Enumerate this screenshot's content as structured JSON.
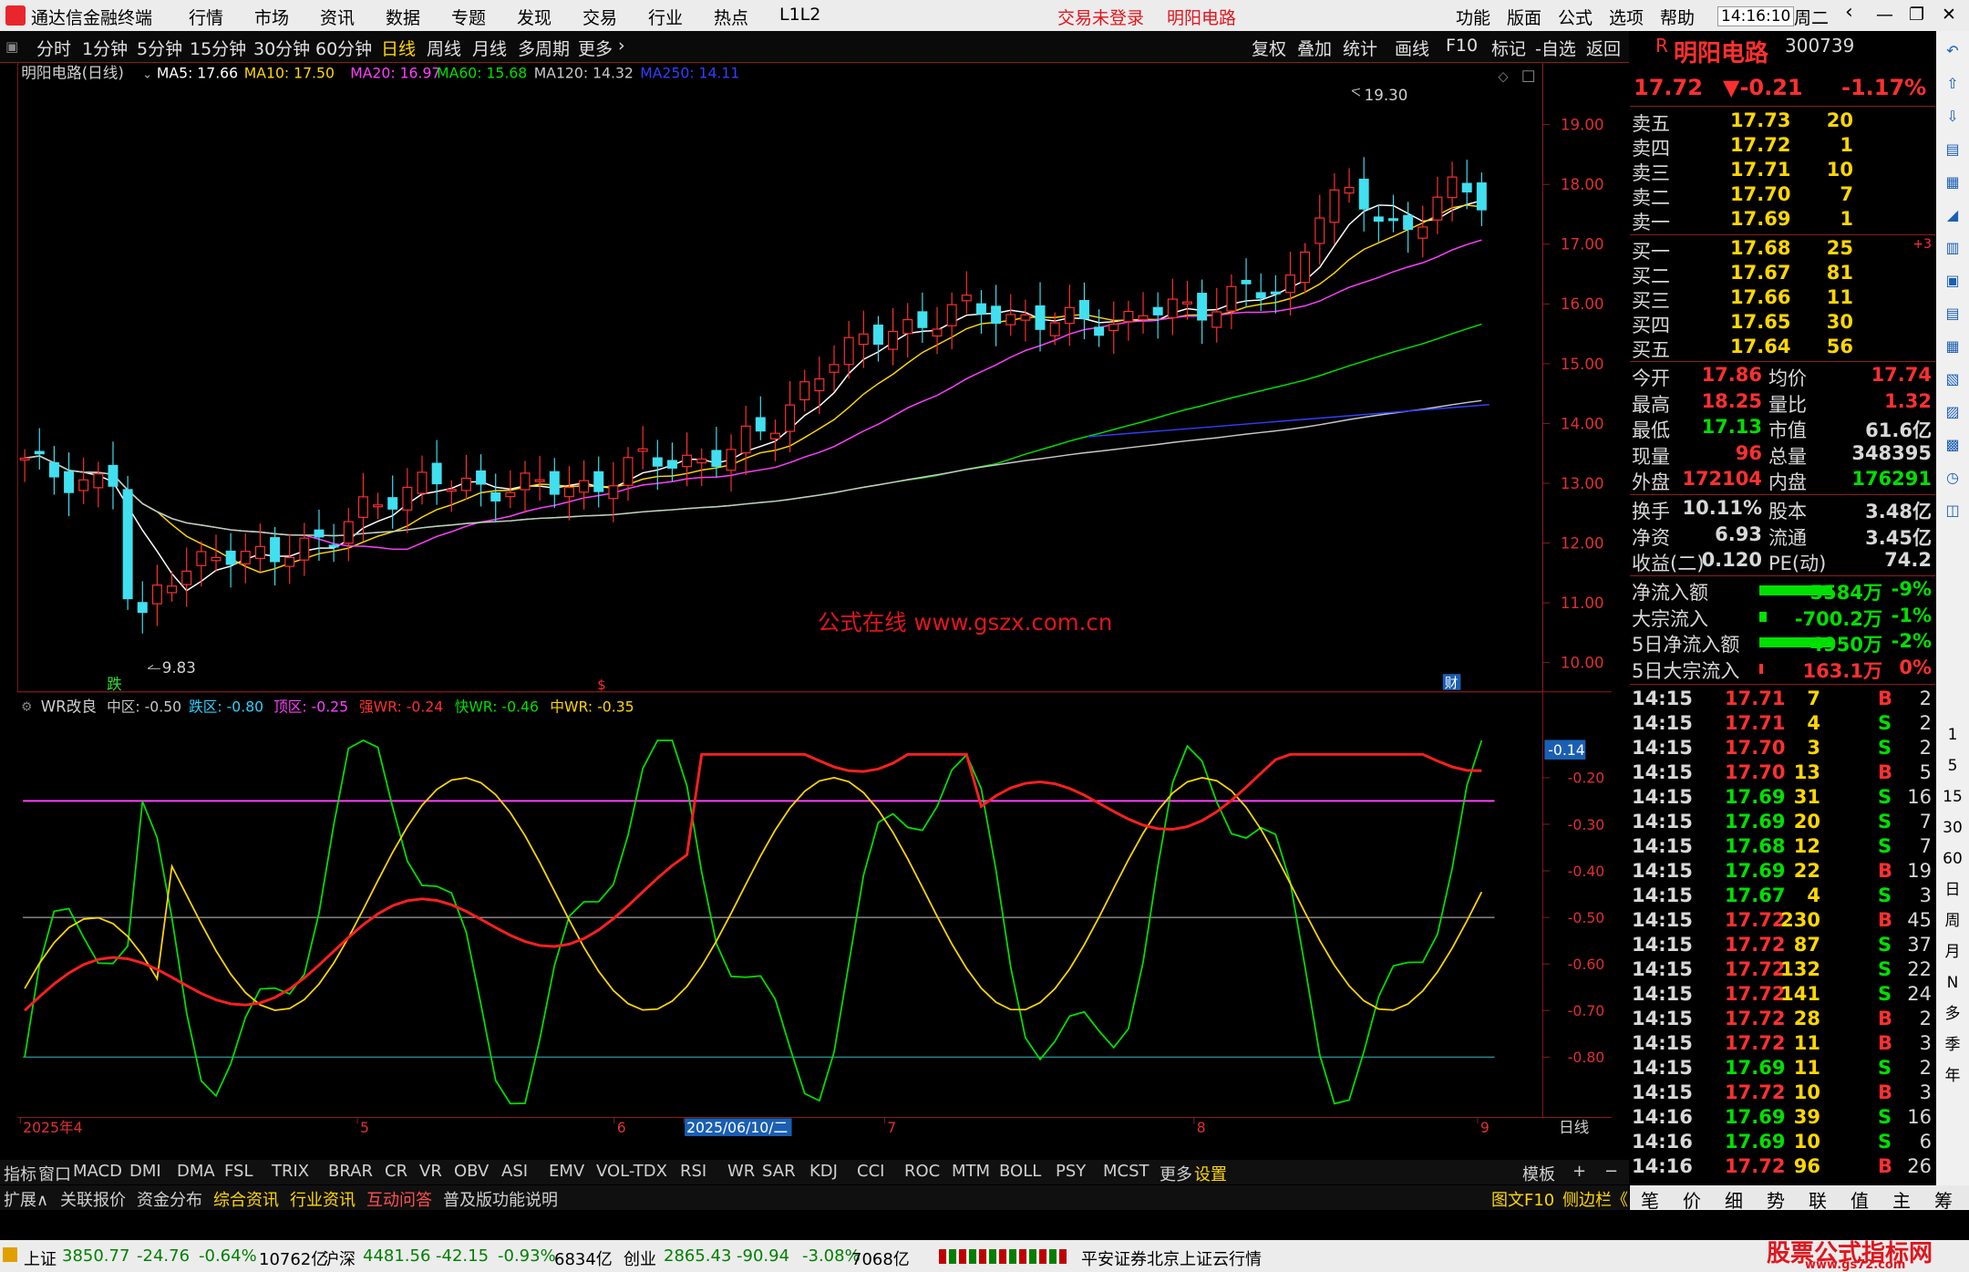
{
  "titlebar": {
    "app_name": "通达信金融终端",
    "menu": [
      "行情",
      "市场",
      "资讯",
      "数据",
      "专题",
      "发现",
      "交易",
      "行业",
      "热点",
      "L1L2"
    ],
    "login_status": "交易未登录",
    "stock_name": "明阳电路",
    "right_menu": [
      "功能",
      "版面",
      "公式",
      "选项",
      "帮助"
    ],
    "time": "14:16:10",
    "weekday": "周二"
  },
  "periodbar": {
    "periods": [
      "分时",
      "1分钟",
      "5分钟",
      "15分钟",
      "30分钟",
      "60分钟",
      "日线",
      "周线",
      "月线",
      "多周期",
      "更多"
    ],
    "active": "日线",
    "tools": [
      "复权",
      "叠加",
      "统计",
      "画线",
      "F10",
      "标记",
      "-自选",
      "返回"
    ]
  },
  "ma_legend": {
    "title": "明阳电路(日线)",
    "items": [
      {
        "label": "MA5: 17.66",
        "color": "#ffffff"
      },
      {
        "label": "MA10: 17.50",
        "color": "#ffd700"
      },
      {
        "label": "MA20: 16.97",
        "color": "#ff40ff"
      },
      {
        "label": "MA60: 15.68",
        "color": "#00e000"
      },
      {
        "label": "MA120: 14.32",
        "color": "#c8c8c8"
      },
      {
        "label": "MA250: 14.11",
        "color": "#3040ff"
      }
    ]
  },
  "price_axis": [
    "19.00",
    "18.00",
    "17.00",
    "16.00",
    "15.00",
    "14.00",
    "13.00",
    "12.00",
    "11.00",
    "10.00"
  ],
  "annotations": {
    "high": "19.30",
    "low": "9.83",
    "watermark": "公式在线  www.gszx.com.cn",
    "marker_die": "跌",
    "marker_s": "$",
    "marker_cai": "财"
  },
  "wr_legend": {
    "title": "WR改良",
    "items": [
      {
        "label": "中区: -0.50",
        "color": "#c8c8c8"
      },
      {
        "label": "跌区: -0.80",
        "color": "#30d0ff"
      },
      {
        "label": "顶区: -0.25",
        "color": "#ff40ff"
      },
      {
        "label": "强WR: -0.24",
        "color": "#ff3030"
      },
      {
        "label": "快WR: -0.46",
        "color": "#00e000"
      },
      {
        "label": "中WR: -0.35",
        "color": "#ffd700"
      }
    ]
  },
  "wr_axis": [
    "-0.14",
    "-0.20",
    "-0.30",
    "-0.40",
    "-0.50",
    "-0.60",
    "-0.70",
    "-0.80"
  ],
  "date_axis": {
    "labels": [
      "2025年4",
      "5",
      "6",
      "2025/06/10/二",
      "7",
      "8",
      "9"
    ],
    "period_label": "日线"
  },
  "indicator_tabs": [
    "指标",
    "窗口",
    "MACD",
    "DMI",
    "DMA",
    "FSL",
    "TRIX",
    "BRAR",
    "CR",
    "VR",
    "OBV",
    "ASI",
    "EMV",
    "VOL-TDX",
    "RSI",
    "WR",
    "SAR",
    "KDJ",
    "CCI",
    "ROC",
    "MTM",
    "BOLL",
    "PSY",
    "MCST",
    "更多",
    "设置",
    "模板",
    "+",
    "−"
  ],
  "ext_tabs": [
    {
      "label": "扩展∧",
      "color": "#d0d0d0"
    },
    {
      "label": "关联报价",
      "color": "#d0d0d0"
    },
    {
      "label": "资金分布",
      "color": "#d0d0d0"
    },
    {
      "label": "综合资讯",
      "color": "#ffd700"
    },
    {
      "label": "行业资讯",
      "color": "#ffd700"
    },
    {
      "label": "互动问答",
      "color": "#ff5050"
    },
    {
      "label": "普及版功能说明",
      "color": "#d0d0d0"
    },
    {
      "label": "图文F10",
      "color": "#ffd700"
    },
    {
      "label": "侧边栏《",
      "color": "#ffd700"
    }
  ],
  "quote": {
    "name": "明阳电路",
    "code": "300739",
    "flag": "R",
    "price": "17.72",
    "change": "▼-0.21",
    "pct": "-1.17%",
    "asks": [
      {
        "label": "卖五",
        "price": "17.73",
        "vol": "20"
      },
      {
        "label": "卖四",
        "price": "17.72",
        "vol": "1"
      },
      {
        "label": "卖三",
        "price": "17.71",
        "vol": "10"
      },
      {
        "label": "卖二",
        "price": "17.70",
        "vol": "7"
      },
      {
        "label": "卖一",
        "price": "17.69",
        "vol": "1"
      }
    ],
    "bids": [
      {
        "label": "买一",
        "price": "17.68",
        "vol": "25",
        "extra": "+3"
      },
      {
        "label": "买二",
        "price": "17.67",
        "vol": "81",
        "extra": ""
      },
      {
        "label": "买三",
        "price": "17.66",
        "vol": "11",
        "extra": ""
      },
      {
        "label": "买四",
        "price": "17.65",
        "vol": "30",
        "extra": ""
      },
      {
        "label": "买五",
        "price": "17.64",
        "vol": "56",
        "extra": ""
      }
    ],
    "stats": [
      {
        "l1": "今开",
        "v1": "17.86",
        "c1": "red",
        "l2": "均价",
        "v2": "17.74",
        "c2": "red"
      },
      {
        "l1": "最高",
        "v1": "18.25",
        "c1": "red",
        "l2": "量比",
        "v2": "1.32",
        "c2": "red"
      },
      {
        "l1": "最低",
        "v1": "17.13",
        "c1": "grn",
        "l2": "市值",
        "v2": "61.6亿",
        "c2": "wht"
      },
      {
        "l1": "现量",
        "v1": "96",
        "c1": "red",
        "l2": "总量",
        "v2": "348395",
        "c2": "wht"
      },
      {
        "l1": "外盘",
        "v1": "172104",
        "c1": "red",
        "l2": "内盘",
        "v2": "176291",
        "c2": "grn"
      }
    ],
    "stats2": [
      {
        "l1": "换手",
        "v1": "10.11%",
        "l2": "股本",
        "v2": "3.48亿"
      },
      {
        "l1": "净资",
        "v1": "6.93",
        "l2": "流通",
        "v2": "3.45亿"
      },
      {
        "l1": "收益(二)",
        "v1": "0.120",
        "l2": "PE(动)",
        "v2": "74.2"
      }
    ],
    "flows": [
      {
        "label": "净流入额",
        "bar": 0.4,
        "value": "-5584万",
        "pct": "-9%"
      },
      {
        "label": "大宗流入",
        "bar": 0.04,
        "value": "-700.2万",
        "pct": "-1%"
      },
      {
        "label": "5日净流入额",
        "bar": 0.4,
        "value": "-4950万",
        "pct": "-2%"
      },
      {
        "label": "5日大宗流入",
        "bar": 0.02,
        "value": "163.1万",
        "pct": "0%"
      }
    ],
    "ticks": [
      {
        "t": "14:15",
        "p": "17.71",
        "v": "7",
        "d": "B",
        "n": "2"
      },
      {
        "t": "14:15",
        "p": "17.71",
        "v": "4",
        "d": "S",
        "n": "2"
      },
      {
        "t": "14:15",
        "p": "17.70",
        "v": "3",
        "d": "S",
        "n": "2"
      },
      {
        "t": "14:15",
        "p": "17.70",
        "v": "13",
        "d": "B",
        "n": "5"
      },
      {
        "t": "14:15",
        "p": "17.69",
        "v": "31",
        "d": "S",
        "n": "16"
      },
      {
        "t": "14:15",
        "p": "17.69",
        "v": "20",
        "d": "S",
        "n": "7"
      },
      {
        "t": "14:15",
        "p": "17.68",
        "v": "12",
        "d": "S",
        "n": "7"
      },
      {
        "t": "14:15",
        "p": "17.69",
        "v": "22",
        "d": "B",
        "n": "19"
      },
      {
        "t": "14:15",
        "p": "17.67",
        "v": "4",
        "d": "S",
        "n": "3"
      },
      {
        "t": "14:15",
        "p": "17.72",
        "v": "230",
        "d": "B",
        "n": "45"
      },
      {
        "t": "14:15",
        "p": "17.72",
        "v": "87",
        "d": "S",
        "n": "37"
      },
      {
        "t": "14:15",
        "p": "17.72",
        "v": "132",
        "d": "S",
        "n": "22"
      },
      {
        "t": "14:15",
        "p": "17.72",
        "v": "141",
        "d": "S",
        "n": "24"
      },
      {
        "t": "14:15",
        "p": "17.72",
        "v": "28",
        "d": "B",
        "n": "2"
      },
      {
        "t": "14:15",
        "p": "17.72",
        "v": "11",
        "d": "B",
        "n": "3"
      },
      {
        "t": "14:15",
        "p": "17.69",
        "v": "11",
        "d": "S",
        "n": "2"
      },
      {
        "t": "14:15",
        "p": "17.72",
        "v": "10",
        "d": "B",
        "n": "3"
      },
      {
        "t": "14:16",
        "p": "17.69",
        "v": "39",
        "d": "S",
        "n": "16"
      },
      {
        "t": "14:16",
        "p": "17.69",
        "v": "10",
        "d": "S",
        "n": "6"
      },
      {
        "t": "14:16",
        "p": "17.72",
        "v": "96",
        "d": "B",
        "n": "26"
      }
    ]
  },
  "right_tabs": [
    "笔",
    "价",
    "细",
    "势",
    "联",
    "值",
    "主",
    "筹"
  ],
  "sidebar_labels": [
    "1",
    "5",
    "15",
    "30",
    "60",
    "日",
    "周",
    "月",
    "N",
    "多",
    "季",
    "年"
  ],
  "statusbar": {
    "indices": [
      {
        "name": "上证",
        "value": "3850.77",
        "chg": "-24.76",
        "pct": "-0.64%",
        "amt": "10762亿"
      },
      {
        "name": "沪深",
        "value": "4481.56",
        "chg": "-42.15",
        "pct": "-0.93%",
        "amt": "6834亿"
      },
      {
        "name": "创业",
        "value": "2865.43",
        "chg": "-90.94",
        "pct": "-3.08%",
        "amt": "7068亿"
      }
    ],
    "broker": "平安证券北京上证云行情",
    "brand": "股票公式指标网",
    "brand_url": "www.gs72.com"
  },
  "chart_data": {
    "type": "candlestick",
    "price_range": [
      9.6,
      19.6
    ],
    "note_series": "daily candles, visually estimated",
    "wr_range": [
      -0.92,
      -0.1
    ],
    "wr_levels": {
      "top": -0.25,
      "mid": -0.5,
      "bottom": -0.8
    }
  }
}
